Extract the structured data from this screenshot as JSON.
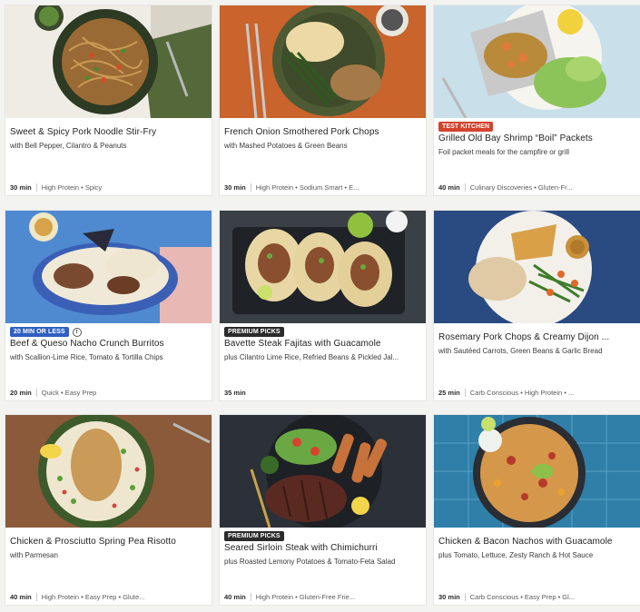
{
  "recipes": [
    {
      "title": "Sweet & Spicy Pork Noodle Stir-Fry",
      "subtitle": "with Bell Pepper, Cilantro & Peanuts",
      "badge": "",
      "time": "30 min",
      "tags": "High Protein • Spicy",
      "image": "pork-noodle-stir-fry-photo"
    },
    {
      "title": "French Onion Smothered Pork Chops",
      "subtitle": "with Mashed Potatoes & Green Beans",
      "badge": "",
      "time": "30 min",
      "tags": "High Protein • Sodium Smart • E...",
      "image": "pork-chops-mashed-potatoes-photo"
    },
    {
      "title": "Grilled Old Bay Shrimp “Boil” Packets",
      "subtitle": "Foil packet meals for the campfire or grill",
      "badge": "Test Kitchen",
      "time": "40 min",
      "tags": "Culinary Discoveries • Gluten-Fr...",
      "image": "shrimp-foil-packet-photo"
    },
    {
      "title": "Beef & Queso Nacho Crunch Burritos",
      "subtitle": "with Scallion-Lime Rice, Tomato & Tortilla Chips",
      "badge": "20 Min or Less",
      "time": "20 min",
      "tags": "Quick • Easy Prep",
      "image": "beef-burritos-photo"
    },
    {
      "title": "Bavette Steak Fajitas with Guacamole",
      "subtitle": "plus Cilantro Lime Rice, Refried Beans & Pickled Jal...",
      "badge": "Premium Picks",
      "time": "35 min",
      "tags": "",
      "image": "steak-fajitas-photo"
    },
    {
      "title": "Rosemary Pork Chops & Creamy Dijon ...",
      "subtitle": "with Sautéed Carrots, Green Beans & Garlic Bread",
      "badge": "",
      "time": "25 min",
      "tags": "Carb Conscious • High Protein • ...",
      "image": "rosemary-pork-chops-photo"
    },
    {
      "title": "Chicken & Prosciutto Spring Pea Risotto",
      "subtitle": "with Parmesan",
      "badge": "",
      "time": "40 min",
      "tags": "High Protein • Easy Prep • Glute...",
      "image": "chicken-risotto-photo"
    },
    {
      "title": "Seared Sirloin Steak with Chimichurri",
      "subtitle": "plus Roasted Lemony Potatoes & Tomato-Feta Salad",
      "badge": "Premium Picks",
      "time": "40 min",
      "tags": "High Protein • Gluten-Free Frie...",
      "image": "sirloin-steak-photo"
    },
    {
      "title": "Chicken & Bacon Nachos with Guacamole",
      "subtitle": "plus Tomato, Lettuce, Zesty Ranch & Hot Sauce",
      "badge": "",
      "time": "30 min",
      "tags": "Carb Conscious • Easy Prep • Gl...",
      "image": "chicken-bacon-nachos-photo"
    }
  ],
  "colors": {
    "test_kitchen_badge": "#d4432c",
    "premium_badge": "#2b2b2b",
    "quick_badge": "#2f5fbf"
  }
}
